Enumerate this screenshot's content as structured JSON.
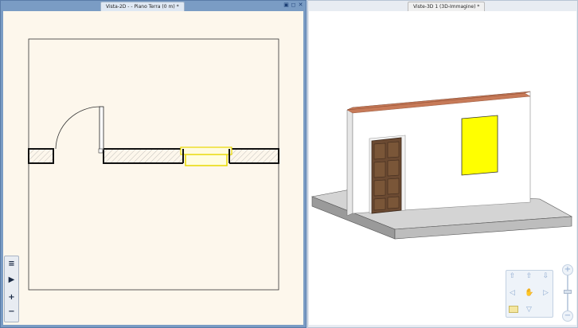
{
  "view_2d": {
    "tab_label": "Vista-2D -  - Piano Terra (0 m) *",
    "controls": {
      "pin": "▣",
      "restore": "◻",
      "close": "✕"
    },
    "toolbar": {
      "list_icon": "≡",
      "play_icon": "▶",
      "zoom_in": "+",
      "zoom_out": "−"
    }
  },
  "view_3d": {
    "tab_label": "Viste-3D 1 (3D-Immagine) *",
    "navigator": {
      "up": "⇧",
      "up_left": "⇧",
      "up_right": "⇩",
      "left": "◁",
      "right": "▷",
      "down": "▽",
      "hand": "✋",
      "zoom_in": "+",
      "zoom_out": "−"
    }
  },
  "colors": {
    "accent_border": "#5a7ca8",
    "window_highlight": "#ffff00",
    "door_wood": "#6b4a32",
    "wall_top": "#c77a58"
  }
}
